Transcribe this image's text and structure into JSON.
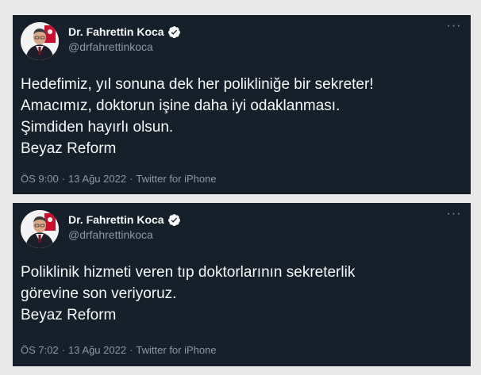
{
  "tweets": [
    {
      "author": {
        "name": "Dr. Fahrettin Koca",
        "handle": "@drfahrettinkoca",
        "verified": true
      },
      "lines": [
        "Hedefimiz, yıl sonuna dek her polikliniğe bir sekreter!",
        "Amacımız, doktorun işine daha iyi odaklanması.",
        "Şimdiden hayırlı olsun.",
        "Beyaz Reform"
      ],
      "time": "ÖS 9:00",
      "separator": "·",
      "date": "13 Ağu 2022",
      "source": "Twitter for iPhone",
      "more_glyph": "···"
    },
    {
      "author": {
        "name": "Dr. Fahrettin Koca",
        "handle": "@drfahrettinkoca",
        "verified": true
      },
      "lines": [
        "Poliklinik hizmeti veren tıp doktorlarının sekreterlik",
        "görevine son veriyoruz.",
        "Beyaz Reform"
      ],
      "time": "ÖS 7:02",
      "separator": "·",
      "date": "13 Ağu 2022",
      "source": "Twitter for iPhone",
      "more_glyph": "···"
    }
  ],
  "colors": {
    "background": "#e9e9e9",
    "card": "#15202b",
    "text": "#f7f9f9",
    "muted": "#8b98a5",
    "verified_badge": "#ffffff"
  }
}
